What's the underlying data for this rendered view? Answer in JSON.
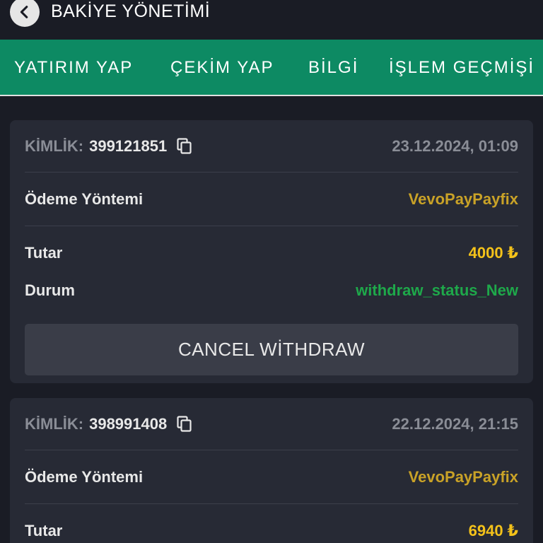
{
  "header": {
    "title": "BAKİYE YÖNETİMİ"
  },
  "tabs": [
    {
      "label": "YATIRIM YAP"
    },
    {
      "label": "ÇEKİM YAP"
    },
    {
      "label": "BİLGİ"
    },
    {
      "label": "İŞLEM GEÇMİŞİ"
    }
  ],
  "transactions": [
    {
      "id_label": "KİMLİK:",
      "id": "399121851",
      "date": "23.12.2024, 01:09",
      "method_label": "Ödeme Yöntemi",
      "method": "VevoPayPayfix",
      "amount_label": "Tutar",
      "amount": "4000 ₺",
      "status_label": "Durum",
      "status": "withdraw_status_New",
      "cancel_label": "CANCEL WİTHDRAW"
    },
    {
      "id_label": "KİMLİK:",
      "id": "398991408",
      "date": "22.12.2024, 21:15",
      "method_label": "Ödeme Yöntemi",
      "method": "VevoPayPayfix",
      "amount_label": "Tutar",
      "amount": "6940 ₺"
    }
  ],
  "colors": {
    "background": "#1a1c25",
    "tab_bar": "#0d8a63",
    "card": "#272a35",
    "method": "#c9a227",
    "amount": "#f4c21a",
    "status": "#1ea84a"
  },
  "icons": {
    "back": "chevron-left-icon",
    "copy": "copy-icon"
  }
}
